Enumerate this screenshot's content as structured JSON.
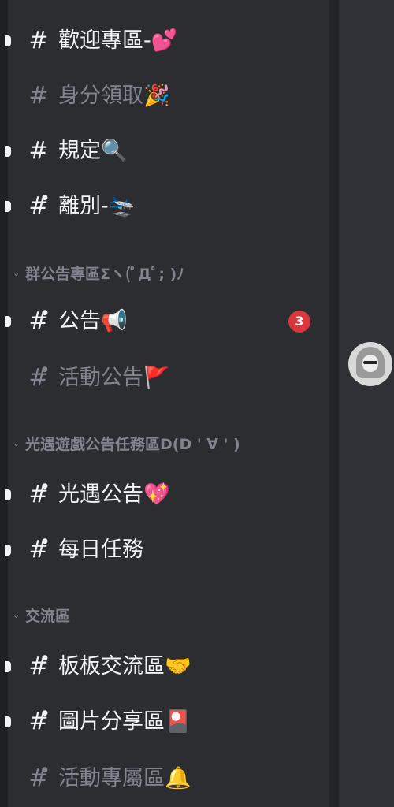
{
  "sidebar": {
    "items": [
      {
        "type": "channel",
        "name": "歡迎專區-💕",
        "locked": false,
        "unread": true,
        "muted": false,
        "badge": null
      },
      {
        "type": "channel",
        "name": "身分領取🎉",
        "locked": false,
        "unread": false,
        "muted": true,
        "badge": null
      },
      {
        "type": "channel",
        "name": "規定🔍",
        "locked": false,
        "unread": true,
        "muted": false,
        "badge": null
      },
      {
        "type": "channel",
        "name": "離別-🛬",
        "locked": true,
        "unread": true,
        "muted": false,
        "badge": null
      },
      {
        "type": "category",
        "name": "群公告專區Σヽ(ﾟДﾟ; )ﾉ"
      },
      {
        "type": "channel",
        "name": "公告📢",
        "locked": true,
        "unread": true,
        "muted": false,
        "badge": "3"
      },
      {
        "type": "channel",
        "name": "活動公告🚩",
        "locked": true,
        "unread": false,
        "muted": true,
        "badge": null
      },
      {
        "type": "category",
        "name": "光遇遊戲公告任務區D(D ' ∀ ' )"
      },
      {
        "type": "channel",
        "name": "光遇公告💖",
        "locked": true,
        "unread": true,
        "muted": false,
        "badge": null
      },
      {
        "type": "channel",
        "name": "每日任務",
        "locked": true,
        "unread": true,
        "muted": false,
        "badge": null
      },
      {
        "type": "category",
        "name": "交流區"
      },
      {
        "type": "channel",
        "name": "板板交流區🤝",
        "locked": true,
        "unread": true,
        "muted": false,
        "badge": null
      },
      {
        "type": "channel",
        "name": "圖片分享區🎴",
        "locked": true,
        "unread": true,
        "muted": false,
        "badge": null
      },
      {
        "type": "channel",
        "name": "活動專屬區🔔",
        "locked": true,
        "unread": false,
        "muted": true,
        "badge": null
      }
    ]
  },
  "icons": {
    "channel": "hash-icon",
    "lock": "lock-icon",
    "category_toggle": "chevron-down-icon"
  },
  "colors": {
    "text_bright": "#f2f3f5",
    "text_muted": "#80848e",
    "badge": "#da373c",
    "panel": "#2b2d31"
  }
}
